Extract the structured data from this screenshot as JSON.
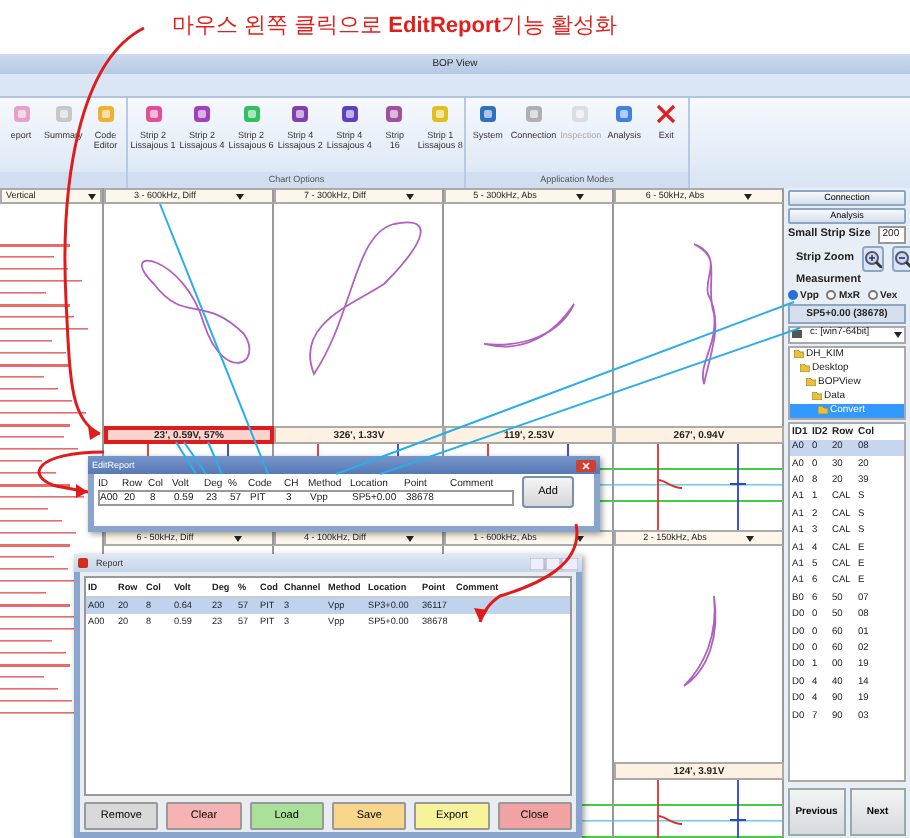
{
  "annotation": {
    "text": "마우스 왼쪽 클릭으로 **EditReport**기능 활성화"
  },
  "window": {
    "title": "BOP View"
  },
  "ribbon": {
    "tools": [
      {
        "label": "eport"
      },
      {
        "label": "Summary"
      },
      {
        "label": "Code\nEditor"
      }
    ],
    "groups": [
      {
        "label": "Chart Options",
        "buttons": [
          {
            "label": "Strip 2\nLissajous 1",
            "disabled": false
          },
          {
            "label": "Strip 2\nLissajous 4",
            "disabled": false
          },
          {
            "label": "Strip 2\nLissajous 6",
            "disabled": false
          },
          {
            "label": "Strip 4\nLissajous 2",
            "disabled": false
          },
          {
            "label": "Strip 4\nLissajous 4",
            "disabled": false
          },
          {
            "label": "Strip\n16",
            "disabled": false
          },
          {
            "label": "Strip 1\nLissajous 8",
            "disabled": false
          }
        ]
      },
      {
        "label": "Application Modes",
        "buttons": [
          {
            "label": "System",
            "disabled": false
          },
          {
            "label": "Connection",
            "disabled": false
          },
          {
            "label": "Inspection",
            "disabled": true
          },
          {
            "label": "Analysis",
            "disabled": false
          },
          {
            "label": "Exit",
            "disabled": false
          }
        ]
      }
    ]
  },
  "left_panel": {
    "dropdown": "Vertical"
  },
  "chart_rows": [
    {
      "panels": [
        {
          "header": "3 - 600kHz, Diff",
          "footer": "23', 0.59V, 57%",
          "selected": true
        },
        {
          "header": "7 - 300kHz, Diff",
          "footer": "326', 1.33V",
          "selected": false
        },
        {
          "header": "5 - 300kHz, Abs",
          "footer": "119', 2.53V",
          "selected": false
        },
        {
          "header": "6 - 50kHz, Abs",
          "footer": "267', 0.94V",
          "selected": false
        }
      ]
    },
    {
      "panels": [
        {
          "header": "6 - 50kHz, Diff",
          "selected": false
        },
        {
          "header": "4 - 100kHz, Diff",
          "selected": false
        },
        {
          "header": "1 - 600kHz, Abs",
          "selected": false
        },
        {
          "header": "2 - 150kHz, Abs",
          "footer": "124', 3.91V",
          "selected": false
        }
      ]
    }
  ],
  "right_panel": {
    "buttons": [
      "Connection",
      "Analysis"
    ],
    "strip_size": {
      "label": "Small Strip Size",
      "value": "200"
    },
    "strip_zoom": {
      "label": "Strip Zoom"
    },
    "measurement": {
      "label": "Measurment",
      "options": [
        {
          "label": "Vpp",
          "selected": true
        },
        {
          "label": "MxR",
          "selected": false
        },
        {
          "label": "Vex",
          "selected": false
        }
      ]
    },
    "location": "SP5+0.00 (38678)",
    "drive": "c: [win7-64bit]",
    "tree": [
      {
        "label": "DH_KIM",
        "selected": false,
        "children": [
          {
            "label": "Desktop",
            "selected": false,
            "children": [
              {
                "label": "BOPView",
                "selected": false,
                "children": [
                  {
                    "label": "Data",
                    "selected": false,
                    "children": [
                      {
                        "label": "Convert",
                        "selected": true
                      }
                    ]
                  }
                ]
              }
            ]
          }
        ]
      }
    ],
    "table": {
      "columns": [
        "ID1",
        "ID2",
        "Row",
        "Col"
      ],
      "rows": [
        {
          "cells": [
            "A0",
            "0",
            "20",
            "08"
          ],
          "selected": true
        },
        {
          "cells": [
            "A0",
            "0",
            "30",
            "20"
          ],
          "selected": false
        },
        {
          "cells": [
            "A0",
            "8",
            "20",
            "39"
          ],
          "selected": false
        },
        {
          "cells": [
            "A1",
            "1",
            "CAL",
            "S"
          ],
          "selected": false
        },
        {
          "cells": [
            "A1",
            "2",
            "CAL",
            "S"
          ],
          "selected": false
        },
        {
          "cells": [
            "A1",
            "3",
            "CAL",
            "S"
          ],
          "selected": false
        },
        {
          "cells": [
            "A1",
            "4",
            "CAL",
            "E"
          ],
          "selected": false
        },
        {
          "cells": [
            "A1",
            "5",
            "CAL",
            "E"
          ],
          "selected": false
        },
        {
          "cells": [
            "A1",
            "6",
            "CAL",
            "E"
          ],
          "selected": false
        },
        {
          "cells": [
            "B0",
            "6",
            "50",
            "07"
          ],
          "selected": false
        },
        {
          "cells": [
            "D0",
            "0",
            "50",
            "08"
          ],
          "selected": false
        },
        {
          "cells": [
            "D0",
            "0",
            "60",
            "01"
          ],
          "selected": false
        },
        {
          "cells": [
            "D0",
            "0",
            "60",
            "02"
          ],
          "selected": false
        },
        {
          "cells": [
            "D0",
            "1",
            "00",
            "19"
          ],
          "selected": false
        },
        {
          "cells": [
            "D0",
            "4",
            "40",
            "14"
          ],
          "selected": false
        },
        {
          "cells": [
            "D0",
            "4",
            "90",
            "19"
          ],
          "selected": false
        },
        {
          "cells": [
            "D0",
            "7",
            "90",
            "03"
          ],
          "selected": false
        }
      ]
    },
    "nav_buttons": [
      "Previous",
      "Next"
    ]
  },
  "edit_report": {
    "title": "EditReport",
    "columns": [
      "ID",
      "Row",
      "Col",
      "Volt",
      "Deg",
      "%",
      "Code",
      "CH",
      "Method",
      "Location",
      "Point",
      "Comment"
    ],
    "values": [
      "A00",
      "20",
      "8",
      "0.59",
      "23",
      "57",
      "PIT",
      "3",
      "Vpp",
      "SP5+0.00",
      "38678"
    ],
    "button": "Add"
  },
  "report": {
    "title": "Report",
    "columns": [
      "ID",
      "Row",
      "Col",
      "Volt",
      "Deg",
      "%",
      "Cod",
      "Channel",
      "Method",
      "Location",
      "Point",
      "Comment"
    ],
    "rows": [
      {
        "cells": [
          "A00",
          "20",
          "8",
          "0.64",
          "23",
          "57",
          "PIT",
          "3",
          "Vpp",
          "SP3+0.00",
          "36117"
        ],
        "selected": true
      },
      {
        "cells": [
          "A00",
          "20",
          "8",
          "0.59",
          "23",
          "57",
          "PIT",
          "3",
          "Vpp",
          "SP5+0.00",
          "38678"
        ],
        "selected": false
      }
    ],
    "buttons": [
      {
        "label": "Remove",
        "color": "#d9d9d9"
      },
      {
        "label": "Clear",
        "color": "#f6b3b3"
      },
      {
        "label": "Load",
        "color": "#a9e19b"
      },
      {
        "label": "Save",
        "color": "#f8d68c"
      },
      {
        "label": "Export",
        "color": "#f6f39a"
      },
      {
        "label": "Close",
        "color": "#f2a2a2"
      }
    ]
  }
}
